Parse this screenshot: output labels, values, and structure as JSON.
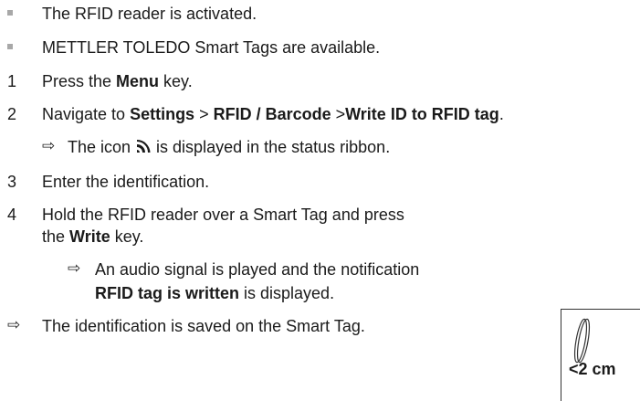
{
  "prerequisites": [
    "The RFID reader is activated.",
    "METTLER TOLEDO Smart Tags are available."
  ],
  "steps": {
    "s1": {
      "num": "1",
      "pre": "Press the ",
      "bold": "Menu",
      "post": " key."
    },
    "s2": {
      "num": "2",
      "pre": "Navigate to ",
      "b1": "Settings",
      "sep1": " > ",
      "b2": "RFID / Barcode",
      "sep2": " >",
      "b3": "Write ID to RFID tag",
      "post": ".",
      "result_pre": "The icon ",
      "icon": "rfid-icon",
      "result_post": " is displayed in the status ribbon."
    },
    "s3": {
      "num": "3",
      "text": "Enter the identification."
    },
    "s4": {
      "num": "4",
      "line1": "Hold the RFID reader over a Smart Tag and press",
      "line2_pre": "the ",
      "line2_bold": "Write",
      "line2_post": " key.",
      "result_line1": "An audio signal is played and the notification",
      "result_line2_bold": "RFID tag is written",
      "result_line2_post": " is displayed."
    }
  },
  "final_result": "The identification is saved on the Smart Tag.",
  "figure": {
    "label": "<2 cm"
  },
  "colors": {
    "bullet": "#a8a8a8",
    "text": "#1a1a1a"
  }
}
